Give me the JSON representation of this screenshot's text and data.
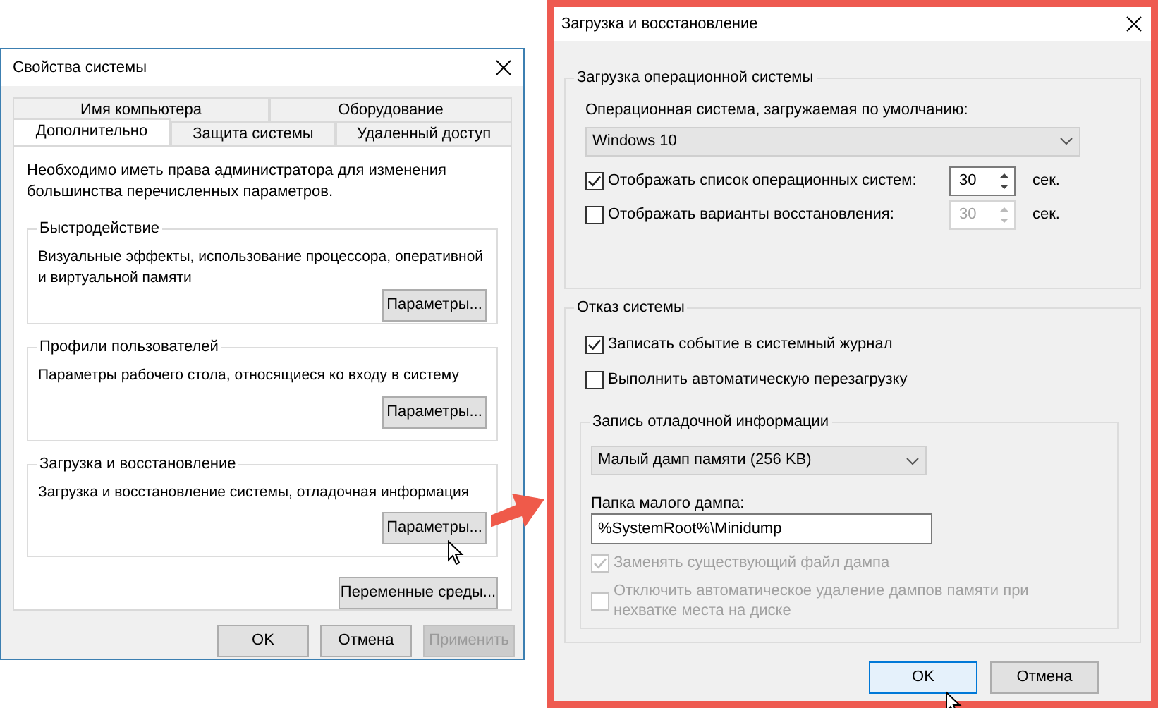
{
  "system_properties": {
    "title": "Свойства системы",
    "tab_rows": [
      {
        "tabs": [
          {
            "label": "Имя компьютера",
            "selected": false
          },
          {
            "label": "Оборудование",
            "selected": false
          }
        ]
      },
      {
        "tabs": [
          {
            "label": "Дополнительно",
            "selected": true
          },
          {
            "label": "Защита системы",
            "selected": false
          },
          {
            "label": "Удаленный доступ",
            "selected": false
          }
        ]
      }
    ],
    "notice": "Необходимо иметь права администратора для изменения большинства перечисленных параметров.",
    "groups": [
      {
        "title": "Быстродействие",
        "description": "Визуальные эффекты, использование процессора, оперативной и виртуальной памяти",
        "button": "Параметры..."
      },
      {
        "title": "Профили пользователей",
        "description": "Параметры рабочего стола, относящиеся ко входу в систему",
        "button": "Параметры..."
      },
      {
        "title": "Загрузка и восстановление",
        "description": "Загрузка и восстановление системы, отладочная информация",
        "button": "Параметры..."
      }
    ],
    "env_button": "Переменные среды...",
    "buttons": [
      {
        "label": "OK",
        "disabled": false
      },
      {
        "label": "Отмена",
        "disabled": false
      },
      {
        "label": "Применить",
        "disabled": true
      }
    ]
  },
  "startup_recovery": {
    "title": "Загрузка и восстановление",
    "os_group": {
      "title": "Загрузка операционной системы",
      "default_os_label": "Операционная система, загружаемая по умолчанию:",
      "default_os": "Windows 10",
      "rows": [
        {
          "label": "Отображать список операционных систем:",
          "checked": true,
          "value": "30",
          "disabled": false,
          "unit": "сек."
        },
        {
          "label": "Отображать варианты восстановления:",
          "checked": false,
          "value": "30",
          "disabled": true,
          "unit": "сек."
        }
      ]
    },
    "failure_group": {
      "title": "Отказ системы",
      "options": [
        {
          "label": "Записать событие в системный журнал",
          "checked": true,
          "disabled": false
        },
        {
          "label": "Выполнить автоматическую перезагрузку",
          "checked": false,
          "disabled": false
        }
      ],
      "debug_group": {
        "title": "Запись отладочной информации",
        "dump_type": "Малый дамп памяти (256 KB)",
        "folder_label": "Папка малого дампа:",
        "folder": "%SystemRoot%\\Minidump",
        "options": [
          {
            "label": "Заменять существующий файл дампа",
            "checked": true,
            "disabled": true
          },
          {
            "label": "Отключить автоматическое удаление дампов памяти при нехватке места на диске",
            "checked": false,
            "disabled": true
          }
        ]
      }
    },
    "buttons": [
      {
        "label": "OK",
        "focused": true
      },
      {
        "label": "Отмена",
        "focused": false
      }
    ]
  }
}
